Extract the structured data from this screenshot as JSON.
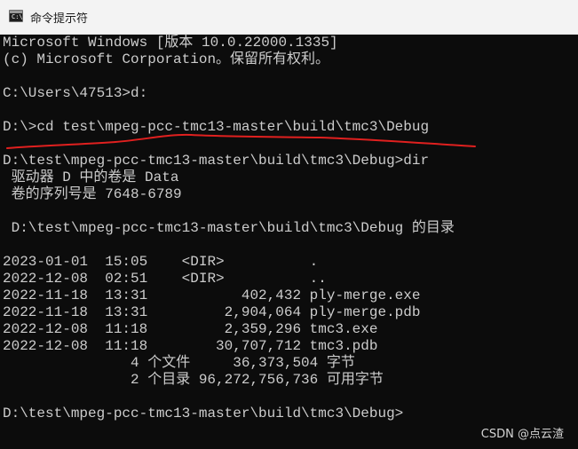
{
  "window": {
    "title": "命令提示符",
    "icon": "cmd-icon",
    "icon_prompt": "C:\\"
  },
  "console": {
    "text_color": "#cccccc",
    "background": "#0c0c0c",
    "lines": [
      "Microsoft Windows [版本 10.0.22000.1335]",
      "(c) Microsoft Corporation。保留所有权利。",
      "",
      "C:\\Users\\47513>d:",
      "",
      "D:\\>cd test\\mpeg-pcc-tmc13-master\\build\\tmc3\\Debug",
      "",
      "D:\\test\\mpeg-pcc-tmc13-master\\build\\tmc3\\Debug>dir",
      " 驱动器 D 中的卷是 Data",
      " 卷的序列号是 7648-6789",
      "",
      " D:\\test\\mpeg-pcc-tmc13-master\\build\\tmc3\\Debug 的目录",
      "",
      "2023-01-01  15:05    <DIR>          .",
      "2022-12-08  02:51    <DIR>          ..",
      "2022-11-18  13:31           402,432 ply-merge.exe",
      "2022-11-18  13:31         2,904,064 ply-merge.pdb",
      "2022-12-08  11:18         2,359,296 tmc3.exe",
      "2022-12-08  11:18        30,707,712 tmc3.pdb",
      "               4 个文件     36,373,504 字节",
      "               2 个目录 96,272,756,736 可用字节",
      "",
      "D:\\test\\mpeg-pcc-tmc13-master\\build\\tmc3\\Debug>"
    ]
  },
  "annotation": {
    "color": "#e0201f",
    "type": "hand-drawn underline"
  },
  "watermark": "CSDN @点云渣"
}
